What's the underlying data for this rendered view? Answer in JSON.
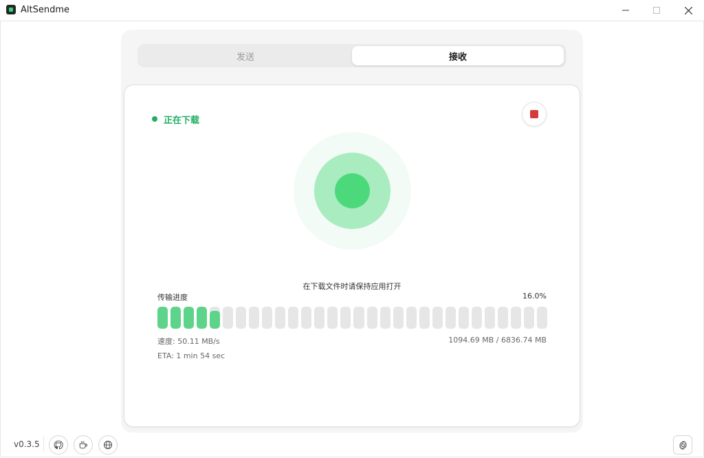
{
  "window": {
    "title": "AltSendme"
  },
  "tabs": [
    {
      "label": "发送",
      "active": false
    },
    {
      "label": "接收",
      "active": true
    }
  ],
  "transfer": {
    "status": "正在下载",
    "status_color": "#1fae63",
    "keep_open_notice": "在下载文件时请保持应用打开",
    "progress_label": "传输进度",
    "progress_percent_text": "16.0%",
    "progress_fraction": 0.16,
    "segment_count": 30,
    "speed": "速度: 50.11 MB/s",
    "size": "1094.69 MB / 6836.74 MB",
    "eta": "ETA: 1 min 54 sec"
  },
  "icons": {
    "stop": "stop-icon",
    "github": "github-icon",
    "coffee": "coffee-icon",
    "globe": "globe-icon",
    "settings": "gear-icon"
  },
  "footer": {
    "version": "v0.3.5"
  },
  "colors": {
    "accent_green": "#5ed38a",
    "stop_red": "#d63a3a"
  }
}
